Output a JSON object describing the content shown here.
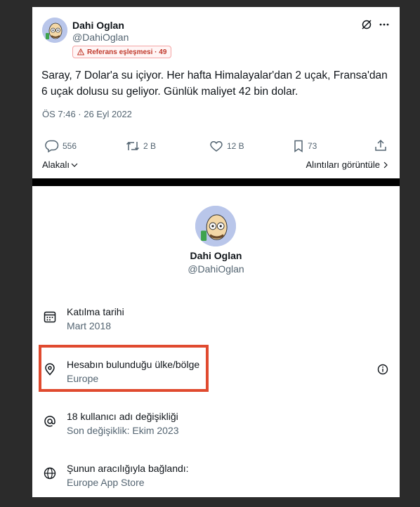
{
  "tweet": {
    "author_name": "Dahi Oglan",
    "author_handle": "@DahiOglan",
    "badge": "Referans eşleşmesi · 49",
    "text": "Saray, 7 Dolar'a su içiyor. Her hafta Himalayalar'dan 2 uçak, Fransa'dan 6 uçak dolusu su geliyor. Günlük maliyet 42 bin dolar.",
    "timestamp": "ÖS 7:46 · 26 Eyl 2022",
    "replies": "556",
    "retweets": "2 B",
    "likes": "12 B",
    "bookmarks": "73",
    "related_label": "Alakalı",
    "quotes_label": "Alıntıları görüntüle"
  },
  "profile": {
    "name": "Dahi Oglan",
    "handle": "@DahiOglan",
    "rows": [
      {
        "label": "Katılma tarihi",
        "value": "Mart 2018",
        "icon": "calendar-icon"
      },
      {
        "label": "Hesabın bulunduğu ülke/bölge",
        "value": "Europe",
        "icon": "location-pin-icon"
      },
      {
        "label": "18 kullanıcı adı değişikliği",
        "value": "Son değişiklik: Ekim 2023",
        "icon": "at-sign-icon"
      },
      {
        "label": "Şunun aracılığıyla bağlandı:",
        "value": "Europe App Store",
        "icon": "globe-icon"
      }
    ]
  },
  "colors": {
    "highlight": "#e04a2f",
    "badge_text": "#c0392b",
    "muted": "#536471"
  }
}
